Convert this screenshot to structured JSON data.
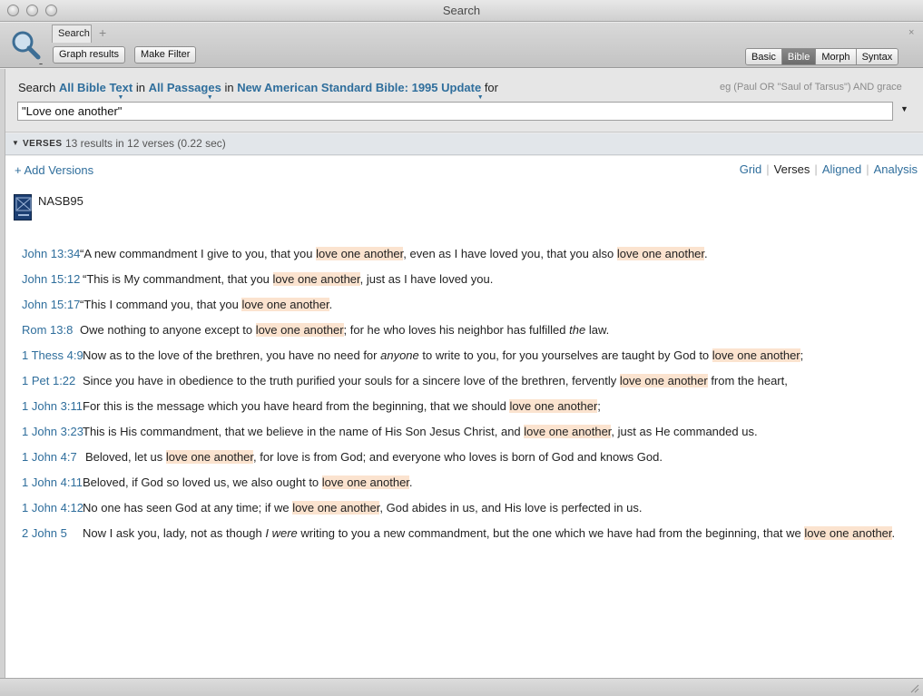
{
  "window": {
    "title": "Search"
  },
  "toolbar": {
    "tab_label": "Search",
    "tab_add": "+",
    "tab_close": "×",
    "graph_results": "Graph results",
    "make_filter": "Make Filter",
    "modes": [
      "Basic",
      "Bible",
      "Morph",
      "Syntax"
    ],
    "active_mode": "Bible"
  },
  "search": {
    "prefix": "Search",
    "scope": "All Bible Text",
    "in1": "in",
    "passages": "All Passages",
    "in2": "in",
    "version": "New American Standard Bible: 1995 Update",
    "for": "for",
    "hint": "eg (Paul OR \"Saul of Tarsus\") AND grace",
    "query": "\"Love one another\""
  },
  "results": {
    "section_label": "VERSES",
    "summary": "13 results in 12 verses (0.22 sec)",
    "add_versions": "+ Add Versions",
    "views": [
      "Grid",
      "Verses",
      "Aligned",
      "Analysis"
    ],
    "current_view": "Verses",
    "book_abbrev": "NASB95",
    "verses": [
      {
        "ref": "John 13:34",
        "text": "“A new commandment I give to you, that you [[love one another]], even as I have loved you, that you also [[love one another]]."
      },
      {
        "ref": "John 15:12",
        "text": " “This is My commandment, that you [[love one another]], just as I have loved you."
      },
      {
        "ref": "John 15:17",
        "text": "“This I command you, that you [[love one another]]."
      },
      {
        "ref": "Rom 13:8",
        "text": "Owe nothing to anyone except to [[love one another]]; for he who loves his neighbor has fulfilled {{the}} law."
      },
      {
        "ref": "1 Thess 4:9",
        "text": "Now as to the love of the brethren, you have no need for {{anyone}} to write to you, for you yourselves are taught by God to [[love one another]];"
      },
      {
        "ref": "1 Pet 1:22",
        "text": "Since you have in obedience to the truth purified your souls for a sincere love of the brethren, fervently [[love one another]] from the heart,"
      },
      {
        "ref": "1 John 3:11",
        "text": "For this is the message which you have heard from the beginning, that we should [[love one another]];"
      },
      {
        "ref": "1 John 3:23",
        "text": "This is His commandment, that we believe in the name of His Son Jesus Christ, and [[love one another]], just as He commanded us."
      },
      {
        "ref": "1 John 4:7",
        "text": " Beloved, let us [[love one another]], for love is from God; and everyone who loves is born of God and knows God."
      },
      {
        "ref": "1 John 4:11",
        "text": "Beloved, if God so loved us, we also ought to [[love one another]]."
      },
      {
        "ref": "1 John 4:12",
        "text": "No one has seen God at any time; if we [[love one another]], God abides in us, and His love is perfected in us."
      },
      {
        "ref": "2 John 5",
        "text": "Now I ask you, lady, not as though {{I were}} writing to you a new commandment, but the one which we have had from the beginning, that we [[love one another]]."
      }
    ]
  },
  "colors": {
    "link": "#2f6e9c",
    "highlight": "#fbe3cf"
  }
}
